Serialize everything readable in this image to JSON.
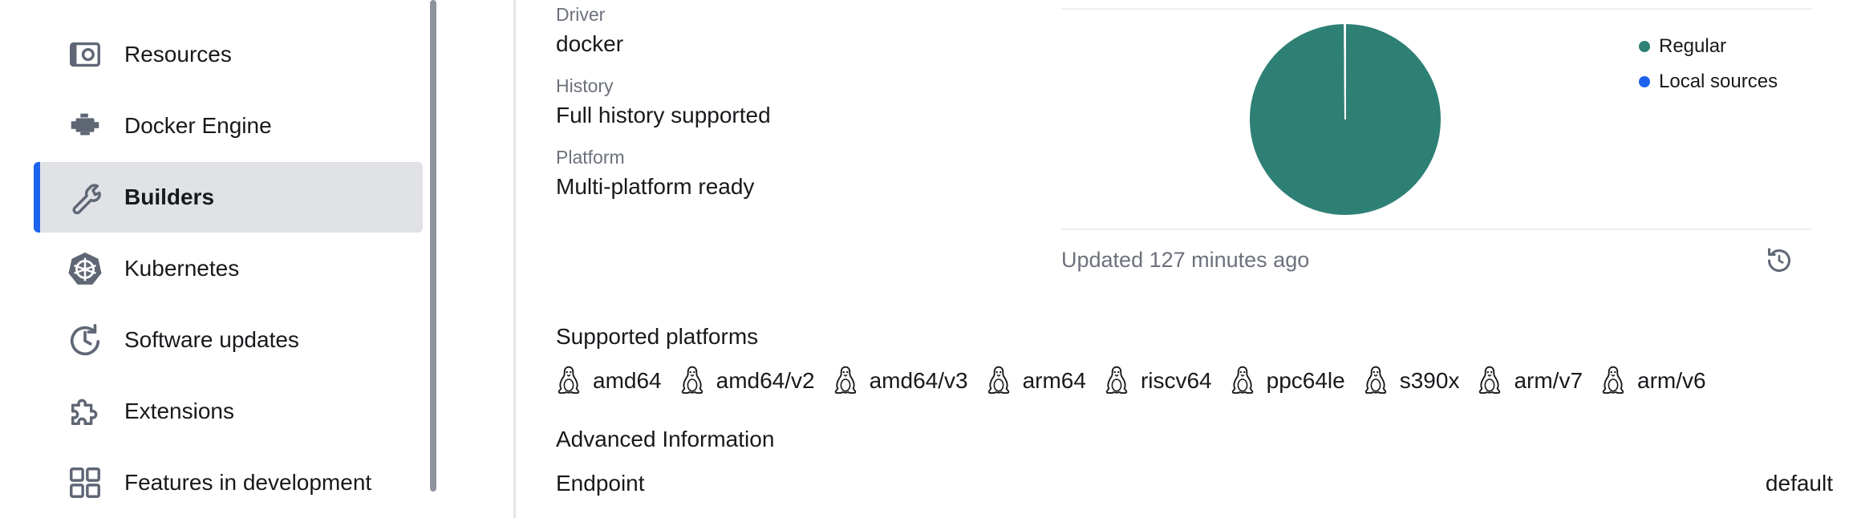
{
  "sidebar": {
    "items": [
      {
        "label": "Resources",
        "icon": "resources-icon",
        "active": false
      },
      {
        "label": "Docker Engine",
        "icon": "engine-icon",
        "active": false
      },
      {
        "label": "Builders",
        "icon": "wrench-icon",
        "active": true
      },
      {
        "label": "Kubernetes",
        "icon": "kubernetes-icon",
        "active": false
      },
      {
        "label": "Software updates",
        "icon": "clock-update-icon",
        "active": false
      },
      {
        "label": "Extensions",
        "icon": "puzzle-icon",
        "active": false
      },
      {
        "label": "Features in development",
        "icon": "grid-icon",
        "active": false
      }
    ]
  },
  "details": {
    "driver_label": "Driver",
    "driver_value": "docker",
    "history_label": "History",
    "history_value": "Full history supported",
    "platform_label": "Platform",
    "platform_value": "Multi-platform ready"
  },
  "usage_chart": {
    "legend": [
      {
        "label": "Regular",
        "color": "#2e8075"
      },
      {
        "label": "Local sources",
        "color": "#1d63ed"
      }
    ],
    "updated_text": "Updated 127 minutes ago"
  },
  "chart_data": {
    "type": "pie",
    "categories": [
      "Regular",
      "Local sources"
    ],
    "values": [
      99.9,
      0.1
    ],
    "colors": [
      "#2e8075",
      "#1d63ed"
    ],
    "legend_position": "top-right"
  },
  "platforms": {
    "title": "Supported platforms",
    "items": [
      "amd64",
      "amd64/v2",
      "amd64/v3",
      "arm64",
      "riscv64",
      "ppc64le",
      "s390x",
      "arm/v7",
      "arm/v6"
    ]
  },
  "advanced": {
    "title": "Advanced Information",
    "endpoint_label": "Endpoint",
    "endpoint_value": "default"
  },
  "colors": {
    "accent": "#1d63ed",
    "active_bg": "#e1e2e6",
    "muted_text": "#6c717c",
    "icon": "#5f6775"
  }
}
